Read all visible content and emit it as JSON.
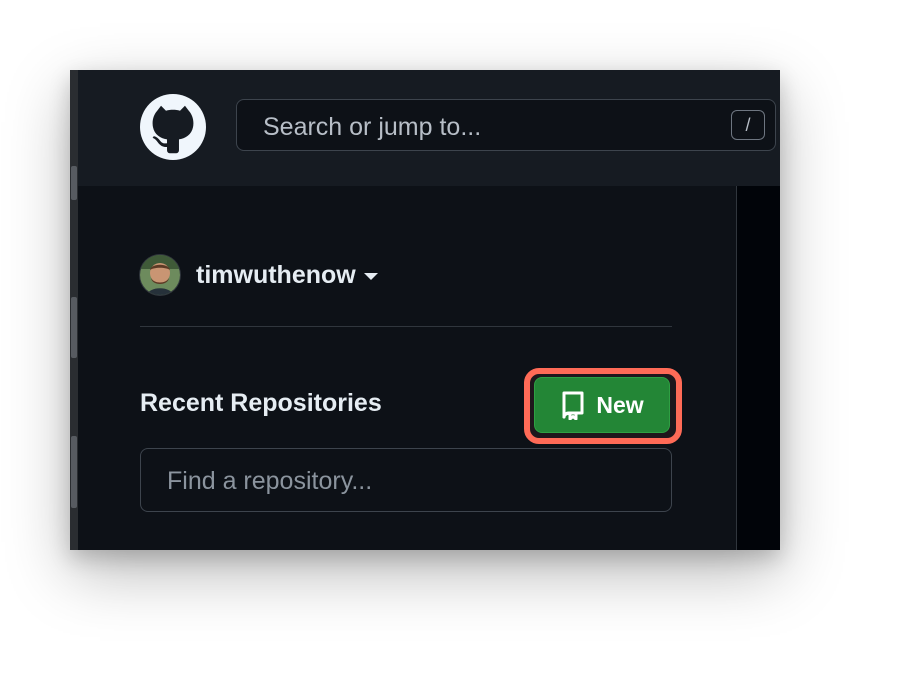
{
  "header": {
    "logo_icon": "github-octocat-icon",
    "search": {
      "placeholder": "Search or jump to...",
      "shortcut_key": "/"
    }
  },
  "sidebar": {
    "account": {
      "username": "timwuthenow",
      "avatar_icon": "user-avatar",
      "dropdown_icon": "caret-down-icon"
    },
    "recent_repositories": {
      "title": "Recent Repositories",
      "new_button_label": "New",
      "new_button_icon": "repo-icon",
      "find_placeholder": "Find a repository..."
    }
  },
  "colors": {
    "background": "#0d1117",
    "header_background": "#161b22",
    "primary_button": "#238636",
    "highlight_outline": "#ff6b57"
  }
}
